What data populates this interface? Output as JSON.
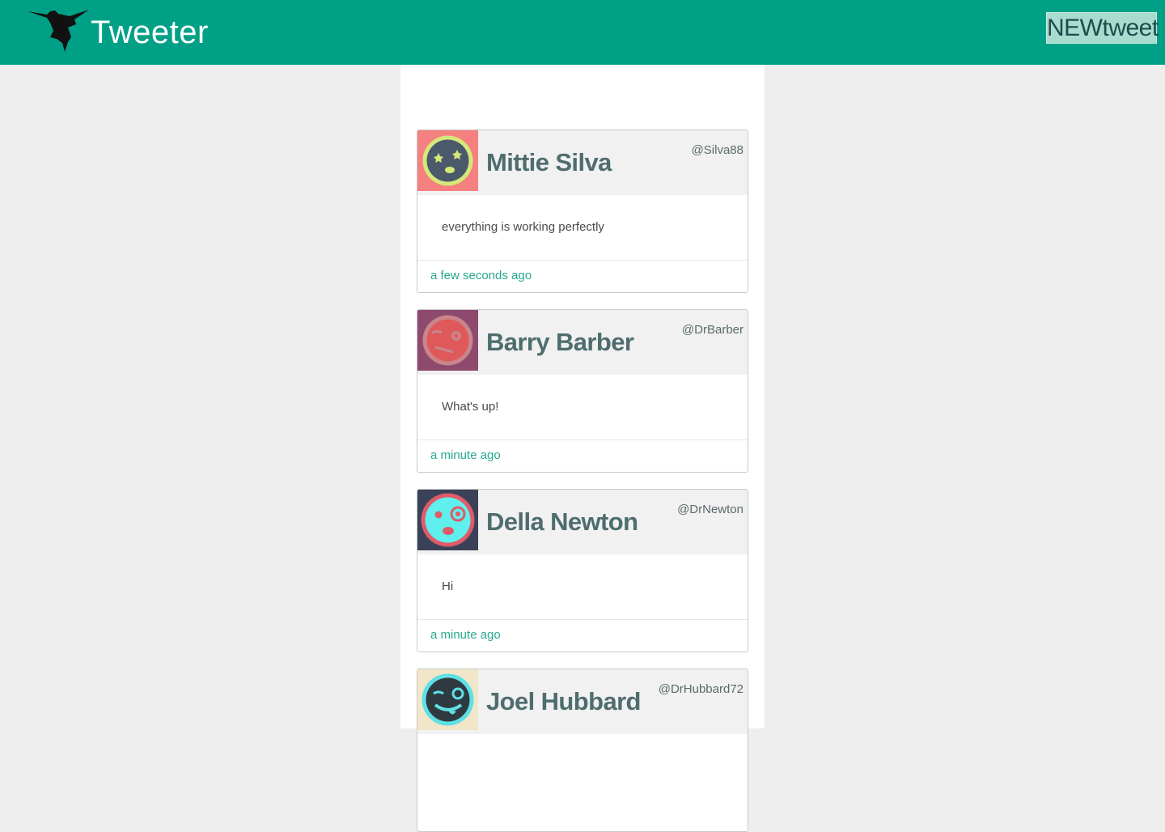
{
  "header": {
    "brand": "Tweeter",
    "new_tweet_label": "NEWtweet",
    "logo_icon": "hummingbird-icon",
    "bar_color": "#00a087"
  },
  "tweets": [
    {
      "name": "Mittie Silva",
      "handle": "@Silva88",
      "text": "everything is working perfectly",
      "time": "a few seconds ago",
      "avatar_icon": "dizzy-face-icon",
      "avatar_bg": "#f58080",
      "avatar_ring": "#d7e87a",
      "avatar_face": "#4a5a6a"
    },
    {
      "name": "Barry Barber",
      "handle": "@DrBarber",
      "text": "What's up!",
      "time": "a minute ago",
      "avatar_icon": "winking-face-icon",
      "avatar_bg": "#8e4a6e",
      "avatar_ring": "#c9868a",
      "avatar_face": "#e0595a"
    },
    {
      "name": "Della Newton",
      "handle": "@DrNewton",
      "text": "Hi",
      "time": "a minute ago",
      "avatar_icon": "surprised-face-icon",
      "avatar_bg": "#3a4258",
      "avatar_ring": "#e05a6a",
      "avatar_face": "#5ff0ee"
    },
    {
      "name": "Joel Hubbard",
      "handle": "@DrHubbard72",
      "text": "",
      "time": "",
      "avatar_icon": "tongue-out-face-icon",
      "avatar_bg": "#f2e6c8",
      "avatar_ring": "#5ee0e6",
      "avatar_face": "#2e3a40"
    }
  ]
}
